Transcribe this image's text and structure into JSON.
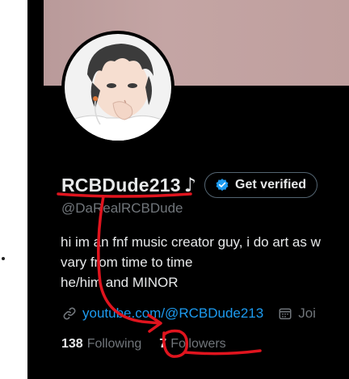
{
  "profile": {
    "display_name": "RCBDude213",
    "name_emoji": "♪",
    "verify_button_label": "Get verified",
    "handle": "@DaRealRCBDude",
    "bio_lines": [
      "hi im an fnf music creator guy, i do art as w",
      "vary from time to time",
      "he/him and MINOR"
    ],
    "link": "youtube.com/@RCBDude213",
    "joined_label": "Joi"
  },
  "stats": {
    "following_count": "138",
    "following_label": "Following",
    "followers_count": "7",
    "followers_label": "Followers"
  },
  "icons": {
    "verify_badge": "verified-badge-icon",
    "link": "link-icon",
    "calendar": "calendar-icon"
  },
  "colors": {
    "background": "#000000",
    "primary_text": "#e7e9ea",
    "secondary_text": "#71767b",
    "link": "#1d9bf0",
    "annotation": "#e0141e",
    "banner": "#c4a5a4"
  }
}
